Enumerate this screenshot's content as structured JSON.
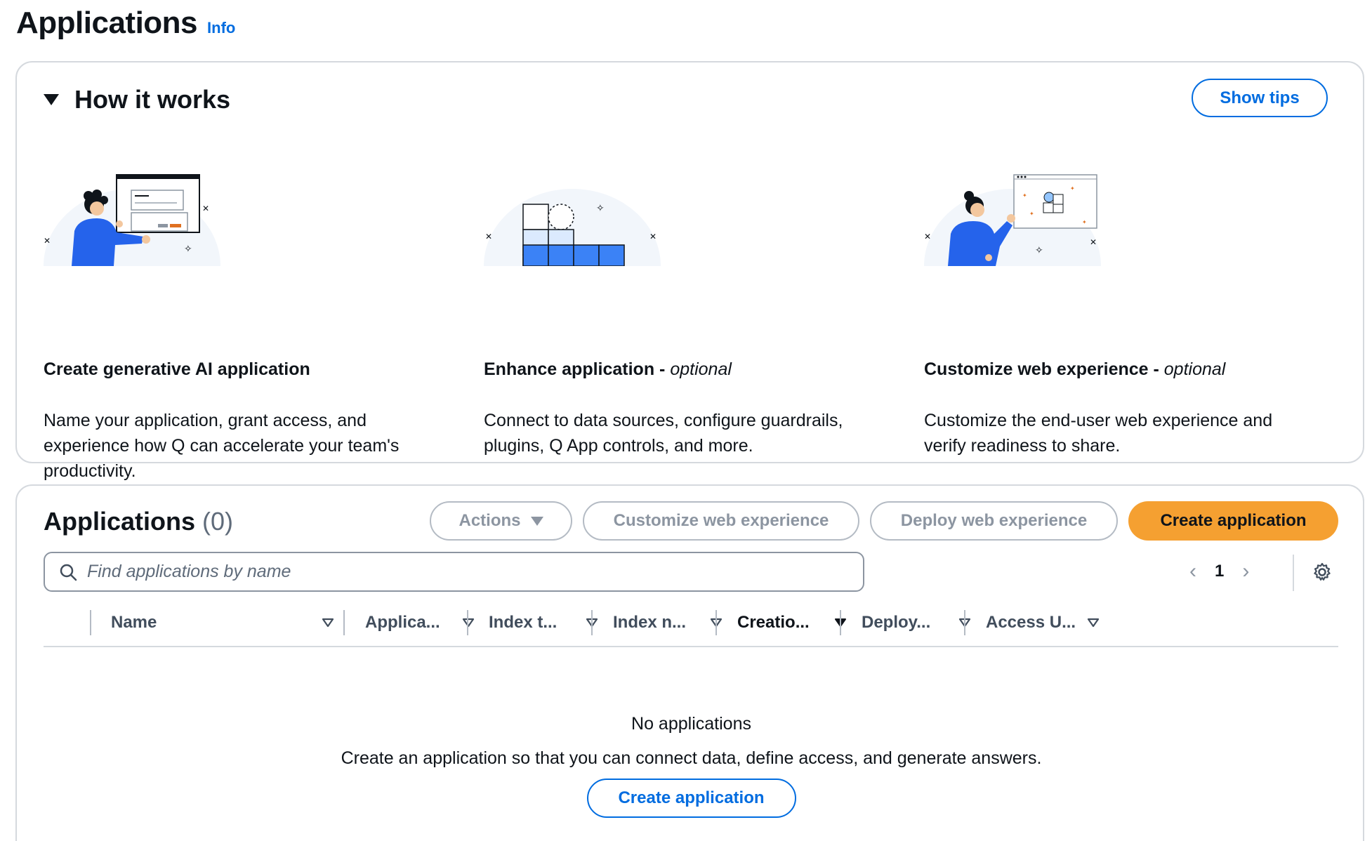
{
  "header": {
    "title": "Applications",
    "info_label": "Info"
  },
  "how_it_works": {
    "title": "How it works",
    "show_tips_label": "Show tips",
    "steps": [
      {
        "title": "Create generative AI application",
        "optional": "",
        "description": "Name your application, grant access, and experience how Q can accelerate your team's productivity."
      },
      {
        "title": "Enhance application - ",
        "optional": "optional",
        "description": "Connect to data sources, configure guardrails, plugins, Q App controls, and more."
      },
      {
        "title": "Customize web experience - ",
        "optional": "optional",
        "description": "Customize the end-user web experience and verify readiness to share."
      }
    ]
  },
  "applications": {
    "title": "Applications",
    "count": "(0)",
    "actions_label": "Actions",
    "customize_label": "Customize web experience",
    "deploy_label": "Deploy web experience",
    "create_label": "Create application",
    "search_placeholder": "Find applications by name",
    "page_number": "1",
    "columns": [
      "Name",
      "Applica...",
      "Index t...",
      "Index n...",
      "Creatio...",
      "Deploy...",
      "Access U..."
    ],
    "empty_title": "No applications",
    "empty_description": "Create an application so that you can connect data, define access, and generate answers.",
    "empty_create_label": "Create application"
  },
  "colors": {
    "link_blue": "#006ce0",
    "primary_orange": "#f5a031",
    "illustration_blue": "#3b82f6",
    "disabled_grey": "#8c95a1"
  }
}
